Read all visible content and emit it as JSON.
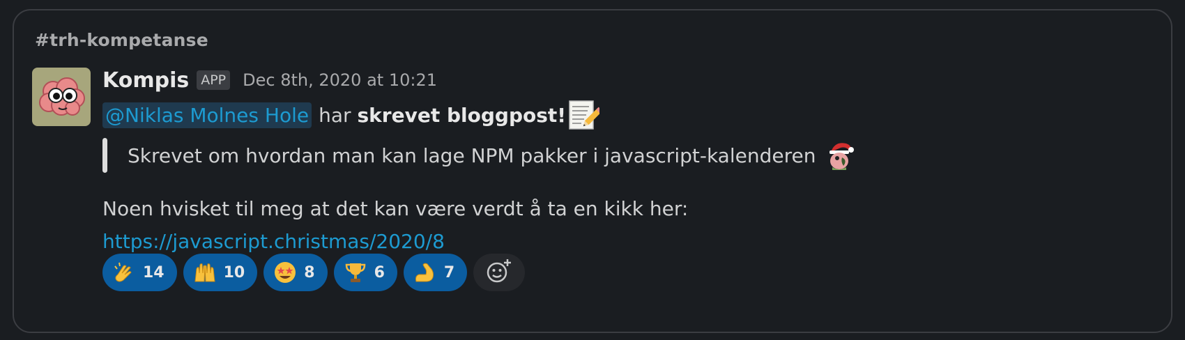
{
  "channel": {
    "name": "#trh-kompetanse"
  },
  "message": {
    "sender": "Kompis",
    "badge": "APP",
    "timestamp": "Dec 8th, 2020 at 10:21",
    "mention": "@Niklas Molnes Hole",
    "verb": "har",
    "action": "skrevet bloggpost!",
    "action_icon": "memo-icon",
    "quote": "Skrevet om hvordan man kan lage NPM pakker i javascript-kalenderen",
    "quote_icon": "santa-parrot-icon",
    "body": "Noen hvisket til meg at det kan være verdt å ta en kikk her:",
    "link": "https://javascript.christmas/2020/8"
  },
  "reactions": [
    {
      "icon": "clap-icon",
      "count": "14"
    },
    {
      "icon": "raised-hands-icon",
      "count": "10"
    },
    {
      "icon": "star-struck-icon",
      "count": "8"
    },
    {
      "icon": "trophy-icon",
      "count": "6"
    },
    {
      "icon": "flexed-biceps-icon",
      "count": "7"
    }
  ],
  "add_reaction": {
    "icon": "add-reaction-icon"
  },
  "colors": {
    "background": "#1a1d21",
    "link": "#1d9bd1",
    "reaction_bg": "#0b5da0",
    "avatar_bg": "#a7a67c"
  }
}
